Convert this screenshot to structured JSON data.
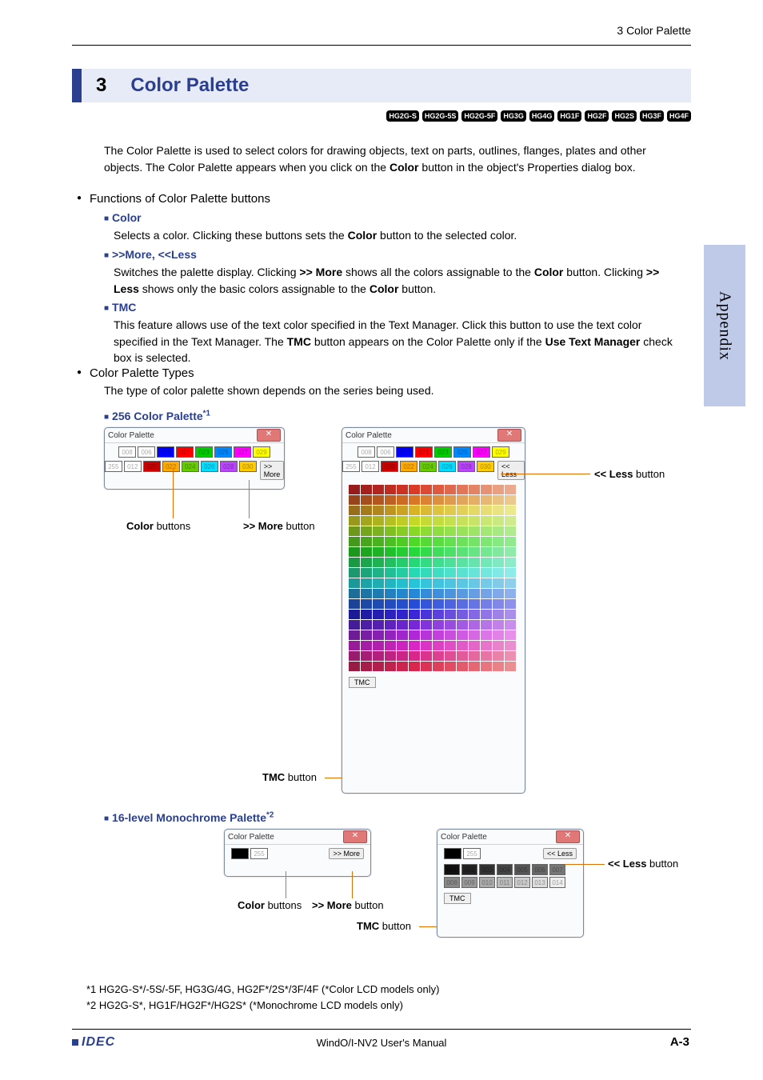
{
  "header": {
    "right": "3 Color Palette"
  },
  "section": {
    "num": "3",
    "title": "Color Palette"
  },
  "tags": [
    "HG2G-S",
    "HG2G-5S",
    "HG2G-5F",
    "HG3G",
    "HG4G",
    "HG1F",
    "HG2F",
    "HG2S",
    "HG3F",
    "HG4F"
  ],
  "intro_html": "The Color Palette is used to select colors for drawing objects, text on parts, outlines, flanges, plates and other objects. The Color Palette appears when you click on the <b>Color</b> button in the object's Properties dialog box.",
  "functions_heading": "Functions of Color Palette buttons",
  "sq_items": [
    {
      "label": "Color",
      "body_html": "Selects a color. Clicking these buttons sets the <b>Color</b> button to the selected color."
    },
    {
      "label": ">>More, <<Less",
      "body_html": "Switches the palette display. Clicking <b>&gt;&gt; More</b> shows all the colors assignable to the <b>Color</b> button. Clicking <b>&gt;&gt; Less</b> shows only the basic colors assignable to the <b>Color</b> button."
    },
    {
      "label": "TMC",
      "body_html": "This feature allows use of the text color specified in the Text Manager. Click this button to use the text color specified in the Text Manager. The <b>TMC</b> button appears on the Color Palette only if the <b>Use Text Manager</b> check box is selected."
    }
  ],
  "types_heading": "Color Palette Types",
  "types_intro": "The type of color palette shown depends on the series being used.",
  "palette256_label_html": "256 Color Palette<sup>*1</sup>",
  "mono_label_html": "16-level Monochrome Palette<sup>*2</sup>",
  "dlg": {
    "title": "Color Palette",
    "more": ">> More",
    "less": "<< Less",
    "tmc": "TMC",
    "row1": [
      "008",
      "006",
      "019",
      "021",
      "023",
      "025",
      "027",
      "029"
    ],
    "row2": [
      "255",
      "012",
      "020",
      "022",
      "024",
      "026",
      "028",
      "030"
    ],
    "row1_colors": [
      "#fff",
      "#fff",
      "#00f",
      "#f00",
      "#0c0",
      "#08f",
      "#f0f",
      "#ff0"
    ],
    "row2_colors": [
      "#fff",
      "#fff",
      "#c00",
      "#fa0",
      "#6c0",
      "#0df",
      "#b4f",
      "#fc0"
    ],
    "mono_row": [
      "000",
      "255"
    ],
    "mono_row_colors": [
      "#000",
      "#fff"
    ],
    "mono_grid": [
      "001",
      "002",
      "003",
      "004",
      "005",
      "006",
      "007",
      "008",
      "009",
      "010",
      "011",
      "012",
      "013",
      "014"
    ],
    "mono_grid_colors": [
      "#111",
      "#222",
      "#333",
      "#444",
      "#555",
      "#666",
      "#777",
      "#888",
      "#999",
      "#aaa",
      "#bbb",
      "#ccc",
      "#ddd",
      "#eee"
    ]
  },
  "callouts": {
    "color_buttons_html": "<b>Color</b> buttons",
    "more_button_html": "<b>&gt;&gt; More</b> button",
    "less_button_html": "<b>&lt;&lt; Less</b> button",
    "tmc_button_html": "<b>TMC</b> button"
  },
  "side_tab": "Appendix",
  "footnotes": [
    "*1  HG2G-S*/-5S/-5F, HG3G/4G, HG2F*/2S*/3F/4F (*Color LCD models only)",
    "*2  HG2G-S*, HG1F/HG2F*/HG2S* (*Monochrome LCD models only)"
  ],
  "footer": {
    "logo": "IDEC",
    "center": "WindO/I-NV2 User's Manual",
    "right_html": "<b>A-3</b>"
  }
}
